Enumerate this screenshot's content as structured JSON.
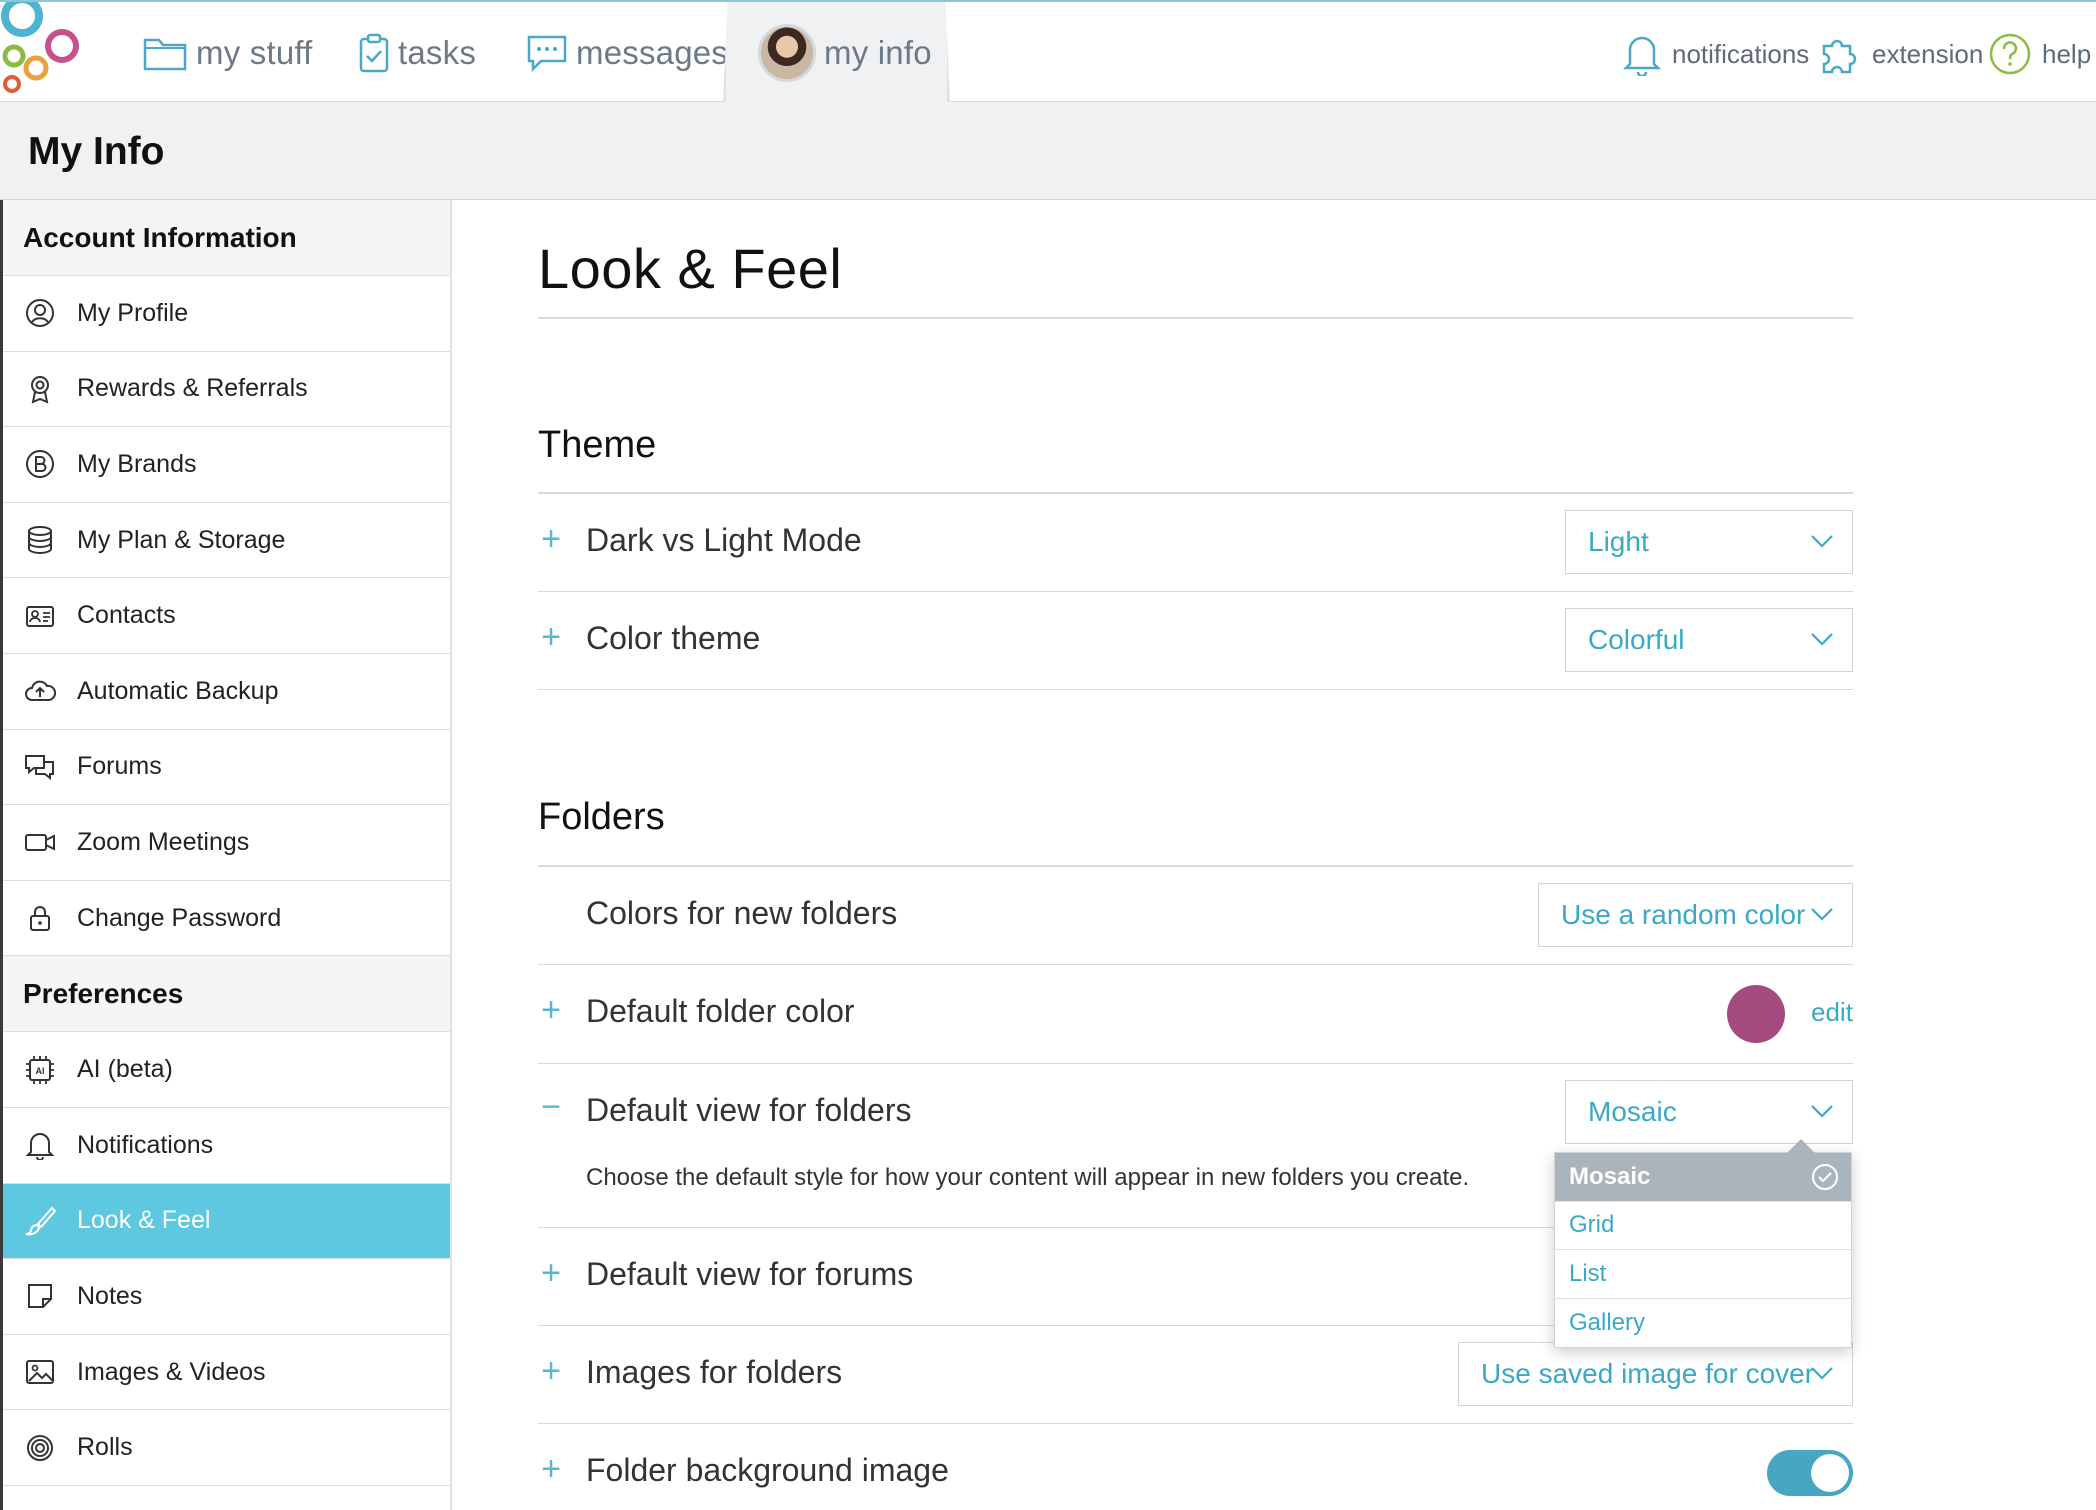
{
  "nav": {
    "items": [
      {
        "label": "my stuff",
        "icon": "folder-icon"
      },
      {
        "label": "tasks",
        "icon": "clipboard-check-icon"
      },
      {
        "label": "messages",
        "icon": "chat-bubble-icon"
      },
      {
        "label": "my info",
        "icon": "avatar",
        "active": true
      }
    ],
    "right": [
      {
        "label": "notifications",
        "icon": "bell-icon"
      },
      {
        "label": "extension",
        "icon": "puzzle-icon"
      },
      {
        "label": "help",
        "icon": "help-circle-icon"
      }
    ]
  },
  "page": {
    "title": "My Info"
  },
  "sidebar": {
    "account_heading": "Account Information",
    "account_items": [
      {
        "label": "My Profile",
        "icon": "user-circle-icon"
      },
      {
        "label": "Rewards & Referrals",
        "icon": "award-icon"
      },
      {
        "label": "My Brands",
        "icon": "brand-b-icon"
      },
      {
        "label": "My Plan & Storage",
        "icon": "database-icon"
      },
      {
        "label": "Contacts",
        "icon": "contact-card-icon"
      },
      {
        "label": "Automatic Backup",
        "icon": "cloud-upload-icon"
      },
      {
        "label": "Forums",
        "icon": "forum-icon"
      },
      {
        "label": "Zoom Meetings",
        "icon": "video-camera-icon"
      },
      {
        "label": "Change Password",
        "icon": "lock-icon"
      }
    ],
    "preferences_heading": "Preferences",
    "preference_items": [
      {
        "label": "AI (beta)",
        "icon": "ai-chip-icon"
      },
      {
        "label": "Notifications",
        "icon": "bell-icon"
      },
      {
        "label": "Look & Feel",
        "icon": "brush-icon",
        "active": true
      },
      {
        "label": "Notes",
        "icon": "note-icon"
      },
      {
        "label": "Images & Videos",
        "icon": "image-icon"
      },
      {
        "label": "Rolls",
        "icon": "spiral-icon"
      }
    ]
  },
  "main": {
    "title": "Look & Feel",
    "theme": {
      "heading": "Theme",
      "dark_light": {
        "label": "Dark vs Light Mode",
        "value": "Light"
      },
      "color_theme": {
        "label": "Color theme",
        "value": "Colorful"
      }
    },
    "folders": {
      "heading": "Folders",
      "new_colors": {
        "label": "Colors for new folders",
        "value": "Use a random color"
      },
      "default_color": {
        "label": "Default folder color",
        "color": "#a54a7e",
        "edit": "edit"
      },
      "default_view": {
        "label": "Default view for folders",
        "value": "Mosaic",
        "description": "Choose the default style for how your content will appear in new folders you create.",
        "options": [
          "Mosaic",
          "Grid",
          "List",
          "Gallery"
        ],
        "selected_option": "Mosaic"
      },
      "forums_view": {
        "label": "Default view for forums"
      },
      "images": {
        "label": "Images for folders",
        "value": "Use saved image for cover"
      },
      "background": {
        "label": "Folder background image",
        "enabled": true
      }
    }
  },
  "colors": {
    "accent": "#3aa9c5",
    "active_sidebar": "#5ec8e0",
    "toggle_on": "#46a6c4"
  }
}
